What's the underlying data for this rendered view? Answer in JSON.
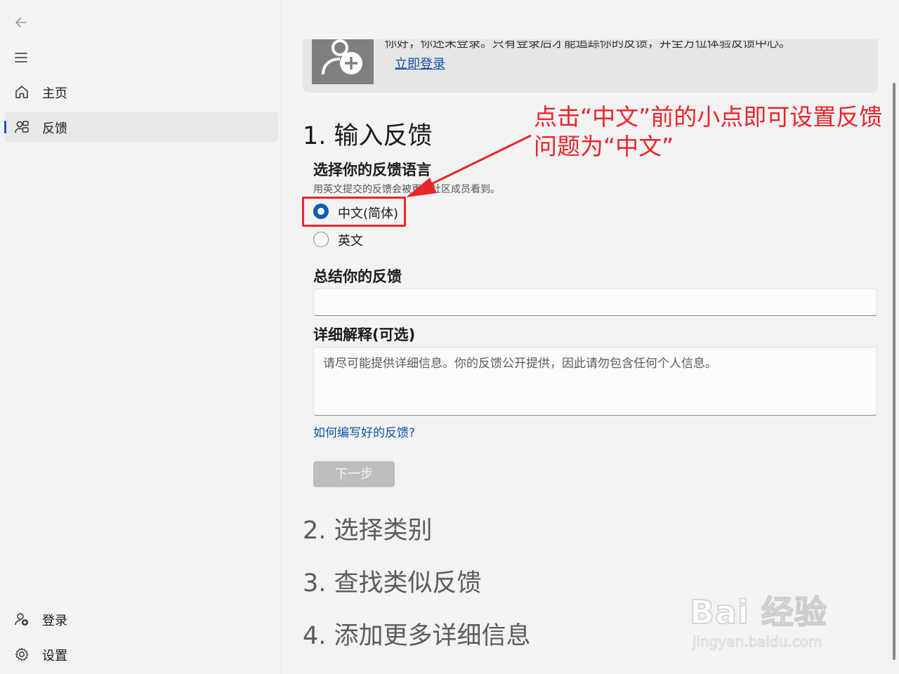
{
  "sidebar": {
    "items": [
      {
        "label": "主页",
        "icon": "home-icon"
      },
      {
        "label": "反馈",
        "icon": "feedback-icon"
      }
    ],
    "bottom_items": [
      {
        "label": "登录",
        "icon": "sign-in-icon"
      },
      {
        "label": "设置",
        "icon": "gear-icon"
      }
    ]
  },
  "login_card": {
    "message": "你好，你还未登录。只有登录后才能追踪你的反馈，并全方位体验反馈中心。",
    "link": "立即登录"
  },
  "steps": [
    {
      "title": "1. 输入反馈"
    },
    {
      "title": "2. 选择类别"
    },
    {
      "title": "3. 查找类似反馈"
    },
    {
      "title": "4. 添加更多详细信息"
    }
  ],
  "language": {
    "heading": "选择你的反馈语言",
    "hint": "用英文提交的反馈会被更多社区成员看到。",
    "options": [
      {
        "label": "中文(简体)",
        "selected": true
      },
      {
        "label": "英文",
        "selected": false
      }
    ]
  },
  "summary": {
    "heading": "总结你的反馈",
    "value": ""
  },
  "details": {
    "heading": "详细解释(可选)",
    "placeholder": "请尽可能提供详细信息。你的反馈公开提供，因此请勿包含任何个人信息。"
  },
  "help_link": "如何编写好的反馈?",
  "next_button": "下一步",
  "annotation": {
    "text": "点击“中文”前的小点即可设置反馈问题为“中文”",
    "color": "#e8262a"
  },
  "watermark": {
    "main": "Bai 经验",
    "sub": "jingyan.baidu.com"
  },
  "colors": {
    "accent": "#0f5cb3",
    "link": "#0f4fa6"
  }
}
